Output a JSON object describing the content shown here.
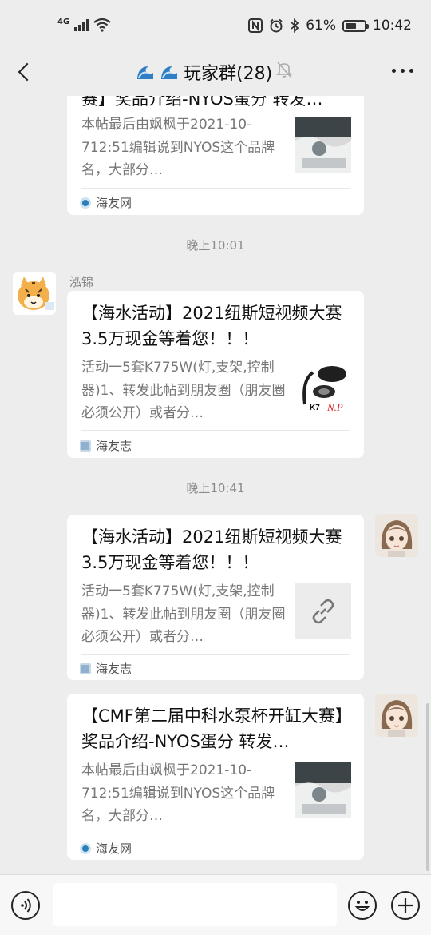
{
  "status_bar": {
    "network": "4G",
    "battery": "61%",
    "battery_level": 0.61,
    "time": "10:42"
  },
  "nav": {
    "title": "玩家群(28)"
  },
  "messages": [
    {
      "title": "赛】奖品介绍-NYOS蛋分 转发…",
      "desc": "本帖最后由飒枫于2021-10-712:51编辑说到NYOS这个品牌名，大部分…",
      "source": "海友网"
    },
    {
      "time": "晚上10:01",
      "sender": "泓锦",
      "title": "【海水活动】2021纽斯短视频大赛 3.5万现金等着您！！！",
      "desc": "活动一5套K775W(灯,支架,控制器)1、转发此帖到朋友圈（朋友圈必须公开）或者分…",
      "source": "海友志"
    },
    {
      "time": "晚上10:41",
      "title": "【海水活动】2021纽斯短视频大赛 3.5万现金等着您！！！",
      "desc": "活动一5套K775W(灯,支架,控制器)1、转发此帖到朋友圈（朋友圈必须公开）或者分…",
      "source": "海友志"
    },
    {
      "title": "【CMF第二届中科水泵杯开缸大赛】奖品介绍-NYOS蛋分 转发…",
      "desc": "本帖最后由飒枫于2021-10-712:51编辑说到NYOS这个品牌名，大部分…",
      "source": "海友网"
    }
  ],
  "thumb_text": {
    "k7": "K7",
    "np": "N.P"
  }
}
